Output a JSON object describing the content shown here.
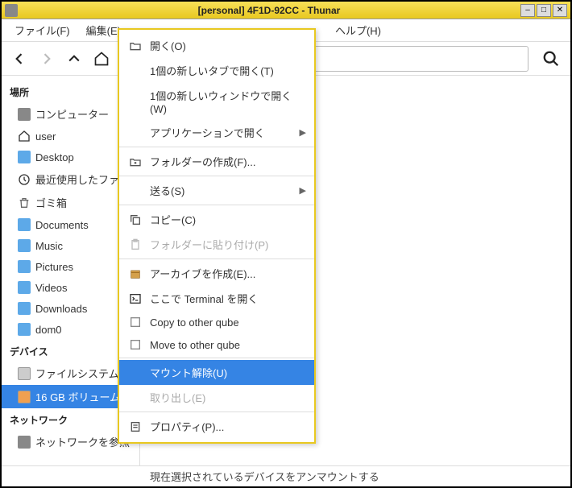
{
  "title": "[personal] 4F1D-92CC - Thunar",
  "menubar": {
    "file": "ファイル(F)",
    "edit": "編集(E)",
    "help": "ヘルプ(H)"
  },
  "sidebar": {
    "places": {
      "header": "場所",
      "items": [
        {
          "label": "コンピューター",
          "icon": "computer"
        },
        {
          "label": "user",
          "icon": "home"
        },
        {
          "label": "Desktop",
          "icon": "folder"
        },
        {
          "label": "最近使用したファイル",
          "icon": "recent"
        },
        {
          "label": "ゴミ箱",
          "icon": "trash"
        },
        {
          "label": "Documents",
          "icon": "folder"
        },
        {
          "label": "Music",
          "icon": "folder"
        },
        {
          "label": "Pictures",
          "icon": "folder"
        },
        {
          "label": "Videos",
          "icon": "folder"
        },
        {
          "label": "Downloads",
          "icon": "folder"
        },
        {
          "label": "dom0",
          "icon": "folder"
        }
      ]
    },
    "devices": {
      "header": "デバイス",
      "items": [
        {
          "label": "ファイルシステム",
          "icon": "drive"
        },
        {
          "label": "16 GB ボリューム",
          "icon": "drive-orange",
          "selected": true
        }
      ]
    },
    "network": {
      "header": "ネットワーク",
      "items": [
        {
          "label": "ネットワークを参照",
          "icon": "network"
        }
      ]
    }
  },
  "context": {
    "open": "開く(O)",
    "open_tab": "1個の新しいタブで開く(T)",
    "open_window": "1個の新しいウィンドウで開く(W)",
    "open_app": "アプリケーションで開く",
    "create_folder": "フォルダーの作成(F)...",
    "send_to": "送る(S)",
    "copy": "コピー(C)",
    "paste_folder": "フォルダーに貼り付け(P)",
    "create_archive": "アーカイブを作成(E)...",
    "open_terminal": "ここで Terminal を開く",
    "copy_qube": "Copy to other qube",
    "move_qube": "Move to other qube",
    "unmount": "マウント解除(U)",
    "eject": "取り出し(E)",
    "properties": "プロパティ(P)..."
  },
  "status": "現在選択されているデバイスをアンマウントする"
}
